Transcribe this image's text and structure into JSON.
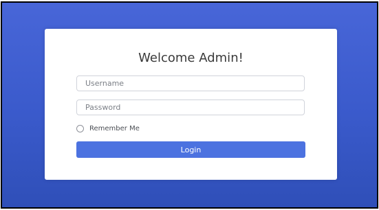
{
  "login": {
    "title": "Welcome Admin!",
    "username_placeholder": "Username",
    "password_placeholder": "Password",
    "remember_label": "Remember Me",
    "login_label": "Login"
  },
  "colors": {
    "background": "#3f5fcf",
    "button": "#4c72e0",
    "card": "#ffffff"
  }
}
